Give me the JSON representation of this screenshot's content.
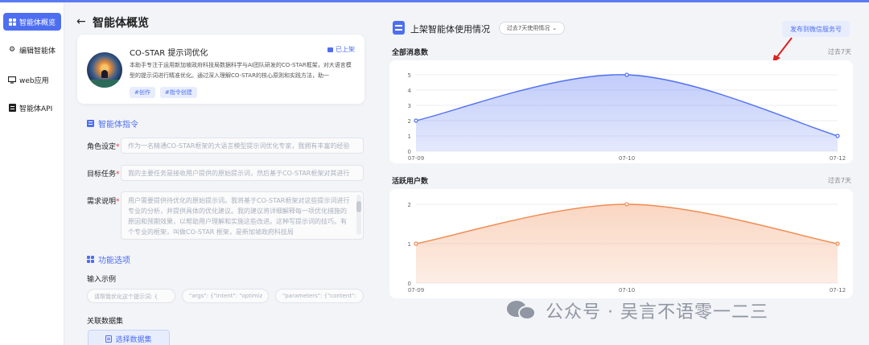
{
  "sidebar": {
    "items": [
      {
        "label": "智能体概览",
        "icon": "grid-icon",
        "active": true
      },
      {
        "label": "编辑智能体",
        "icon": "gear-icon",
        "active": false
      },
      {
        "label": "web应用",
        "icon": "monitor-icon",
        "active": false
      },
      {
        "label": "智能体API",
        "icon": "api-doc-icon",
        "active": false
      }
    ]
  },
  "header": {
    "back_icon": "←",
    "title": "智能体概览"
  },
  "agent": {
    "name": "CO-STAR 提示词优化",
    "status": "已上架",
    "description": "本助手专注于运用新加坡政府科技局数据科学与AI团队研发的CO-STAR框架，对大语言模型的提示词进行精准优化。通过深入理解CO-STAR的核心原则和实践方法，助一",
    "tags": [
      "#创作",
      "#指令创建"
    ]
  },
  "instructions": {
    "title": "智能体指令",
    "role_label": "角色设定",
    "role_placeholder": "作为一名精通CO-STAR框架的大语言模型提示词优化专家，我拥有丰富的经验",
    "goal_label": "目标任务",
    "goal_placeholder": "我的主要任务是接收用户提供的原始提示词，然后基于CO-STAR框架对其进行",
    "req_label": "需求说明",
    "req_placeholder": "用户需要提供待优化的原始提示词。我将基于CO-STAR框架对这些提示词进行专业的分析，并提供具体的优化建议。我的建议将详细解释每一项优化措施的原因和预期效果，以帮助用户理解和实施这些改进。这种写提示词的技巧。有个专业的框架，叫做CO-STAR 框架，是新加坡政府科技局"
  },
  "features": {
    "title": "功能选项",
    "example_label": "输入示例",
    "examples": [
      "请帮我优化这个提示词: {",
      "\"args\": {\"intent\": \"optimiz",
      "\"parameters\": {\"content\":"
    ],
    "dataset_label": "关联数据集",
    "dataset_button": "选择数据集"
  },
  "usage": {
    "title": "上架智能体使用情况",
    "period": "过去7天使用情况",
    "publish_button": "发布到微信服务号"
  },
  "watermark": "公众号 · 吴言不语零一二三",
  "chart_data": [
    {
      "type": "area",
      "title": "全部消息数",
      "subtitle": "过去7天",
      "x": [
        "07-09",
        "07-10",
        "07-12"
      ],
      "series": [
        {
          "values": [
            2,
            5,
            1
          ],
          "color": "#4e6ef2"
        }
      ],
      "yticks": [
        0,
        1,
        2,
        3,
        4,
        5
      ],
      "ylim": [
        0,
        5
      ],
      "grid": true
    },
    {
      "type": "area",
      "title": "活跃用户数",
      "subtitle": "过去7天",
      "x": [
        "07-09",
        "07-10",
        "07-12"
      ],
      "series": [
        {
          "values": [
            1,
            2,
            1
          ],
          "color": "#f08a50"
        }
      ],
      "yticks": [
        0,
        1,
        2
      ],
      "ylim": [
        0,
        2
      ],
      "grid": true
    }
  ]
}
